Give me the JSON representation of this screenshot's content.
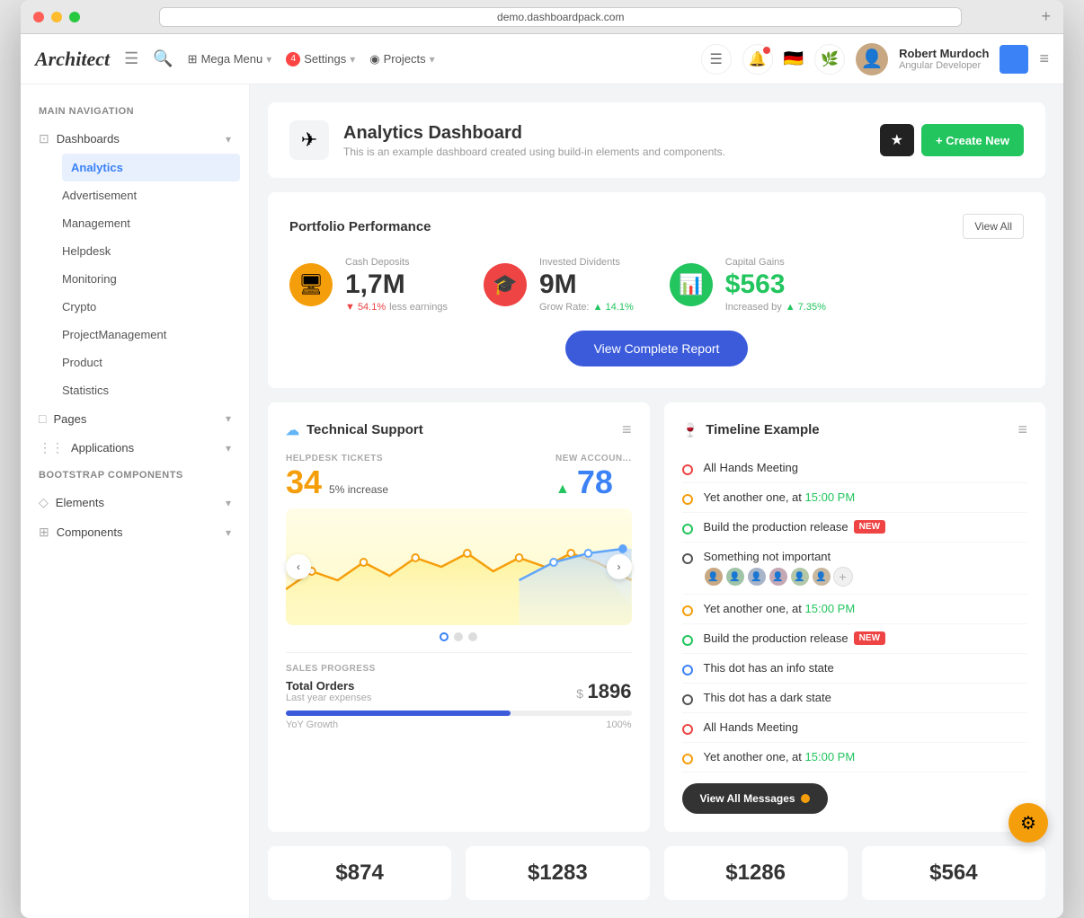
{
  "window": {
    "url": "demo.dashboardpack.com"
  },
  "topbar": {
    "logo": "Architect",
    "mega_menu": "Mega Menu",
    "settings": "Settings",
    "settings_badge": "4",
    "projects": "Projects",
    "user_name": "Robert Murdoch",
    "user_role": "Angular Developer"
  },
  "sidebar": {
    "main_nav_title": "MAIN NAVIGATION",
    "dashboards_label": "Dashboards",
    "nav_items": [
      {
        "label": "Analytics",
        "active": true
      },
      {
        "label": "Advertisement",
        "active": false
      },
      {
        "label": "Management",
        "active": false
      },
      {
        "label": "Helpdesk",
        "active": false
      },
      {
        "label": "Monitoring",
        "active": false
      },
      {
        "label": "Crypto",
        "active": false
      },
      {
        "label": "ProjectManagement",
        "active": false
      },
      {
        "label": "Product",
        "active": false
      },
      {
        "label": "Statistics",
        "active": false
      }
    ],
    "pages_label": "Pages",
    "applications_label": "Applications",
    "bootstrap_title": "BOOTSTRAP COMPONENTS",
    "elements_label": "Elements",
    "components_label": "Components"
  },
  "page_header": {
    "title": "Analytics Dashboard",
    "subtitle": "This is an example dashboard created using build-in elements and components.",
    "star_label": "★",
    "create_label": "+ Create New"
  },
  "portfolio": {
    "title": "Portfolio Performance",
    "view_all": "View All",
    "metrics": [
      {
        "label": "Cash Deposits",
        "value": "1,7M",
        "sub_down": "▼ 54.1%",
        "sub_text": " less earnings",
        "color": "yellow",
        "icon": "🖥"
      },
      {
        "label": "Invested Dividents",
        "value": "9M",
        "sub_label": "Grow Rate:",
        "sub_up": "▲ 14.1%",
        "color": "red",
        "icon": "🎓"
      },
      {
        "label": "Capital Gains",
        "value": "$563",
        "sub_text": "Increased by",
        "sub_up": " ▲ 7.35%",
        "color": "green",
        "icon": "📊"
      }
    ],
    "report_btn": "View Complete Report"
  },
  "technical_support": {
    "title": "Technical Support",
    "tickets_label": "HELPDESK TICKETS",
    "tickets_value": "34",
    "tickets_change_pct": "5%",
    "tickets_change_text": "increase",
    "new_accounts_label": "NEW ACCOUN...",
    "new_accounts_value": "78",
    "new_accounts_up": "▲",
    "sales_progress_label": "SALES PROGRESS",
    "total_orders_label": "Total Orders",
    "total_orders_sub": "Last year expenses",
    "total_orders_value": "$ 1896",
    "yoy_label": "YoY Growth",
    "yoy_pct": "100%",
    "progress": 65
  },
  "timeline": {
    "title": "Timeline Example",
    "items": [
      {
        "text": "All Hands Meeting",
        "dot": "red",
        "sub": ""
      },
      {
        "text": "Yet another one, at 15:00 PM",
        "dot": "yellow",
        "sub": ""
      },
      {
        "text": "Build the production release",
        "dot": "green",
        "badge": "NEW",
        "sub": ""
      },
      {
        "text": "Something not important",
        "dot": "dark",
        "avatars": true,
        "sub": ""
      },
      {
        "text": "Yet another one, at 15:00 PM",
        "dot": "yellow",
        "sub": ""
      },
      {
        "text": "Build the production release",
        "dot": "green",
        "badge": "NEW",
        "sub": ""
      },
      {
        "text": "This dot has an info state",
        "dot": "blue",
        "sub": ""
      },
      {
        "text": "This dot has a dark state",
        "dot": "dark",
        "sub": ""
      },
      {
        "text": "All Hands Meeting",
        "dot": "red",
        "sub": ""
      },
      {
        "text": "Yet another one, at 15:00 PM",
        "dot": "yellow",
        "sub": ""
      }
    ],
    "view_messages_btn": "View All Messages"
  },
  "bottom_stats": [
    {
      "value": "$874"
    },
    {
      "value": "$1283"
    },
    {
      "value": "$1286"
    },
    {
      "value": "$564"
    }
  ],
  "settings_fab": "⚙"
}
